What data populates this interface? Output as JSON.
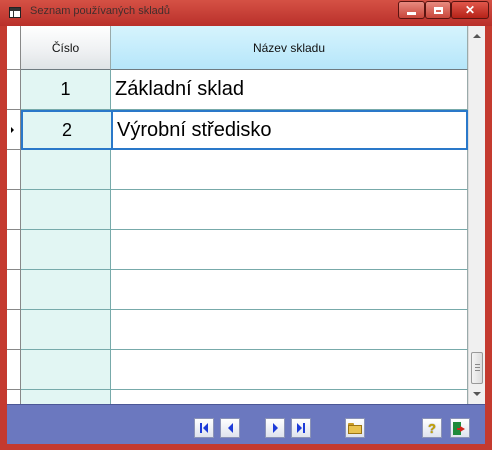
{
  "window": {
    "title": "Seznam používaných skladů"
  },
  "grid": {
    "columns": [
      "Číslo",
      "Název skladu"
    ],
    "rows": [
      {
        "cislo": "1",
        "nazev": "Základní sklad"
      },
      {
        "cislo": "2",
        "nazev": "Výrobní středisko"
      }
    ],
    "empty_rows": 6,
    "selected_row": 2
  },
  "toolbar": {
    "buttons": [
      "first-record-icon",
      "previous-record-icon",
      "next-record-icon",
      "last-record-icon",
      "open-folder-icon",
      "help-icon",
      "exit-icon"
    ],
    "help_label": "?"
  },
  "colors": {
    "title_bar": "#c43a2f",
    "number_column": "#e2f6f3",
    "header_active": "#b6e6fa",
    "toolbar": "#6b78bf",
    "selection": "#2a78c9"
  }
}
